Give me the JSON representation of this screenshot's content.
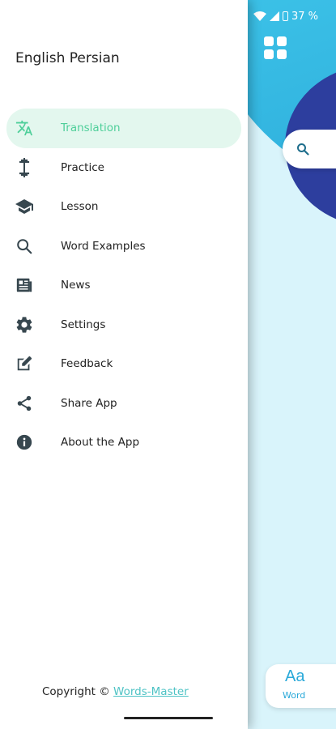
{
  "status_bar": {
    "battery": "37 %"
  },
  "background_app": {
    "bottom_tab": {
      "glyph": "Aa",
      "label": "Word"
    }
  },
  "drawer": {
    "title": "English Persian",
    "items": [
      {
        "label": "Translation",
        "icon": "translate-icon",
        "active": true
      },
      {
        "label": "Practice",
        "icon": "dumbbell-icon"
      },
      {
        "label": "Lesson",
        "icon": "graduation-cap-icon"
      },
      {
        "label": "Word Examples",
        "icon": "search-icon"
      },
      {
        "label": "News",
        "icon": "newspaper-icon"
      },
      {
        "label": "Settings",
        "icon": "gear-icon"
      },
      {
        "label": "Feedback",
        "icon": "edit-icon"
      },
      {
        "label": "Share App",
        "icon": "share-icon"
      },
      {
        "label": "About the App",
        "icon": "info-icon"
      }
    ],
    "copyright_prefix": "Copyright © ",
    "copyright_link": "Words-Master"
  },
  "colors": {
    "accent_green": "#4fcf9a",
    "active_bg": "#e3f7ee",
    "header_blue": "#2aa9d9",
    "blob_navy": "#2d3e9e",
    "icon_gray": "#37474f"
  }
}
